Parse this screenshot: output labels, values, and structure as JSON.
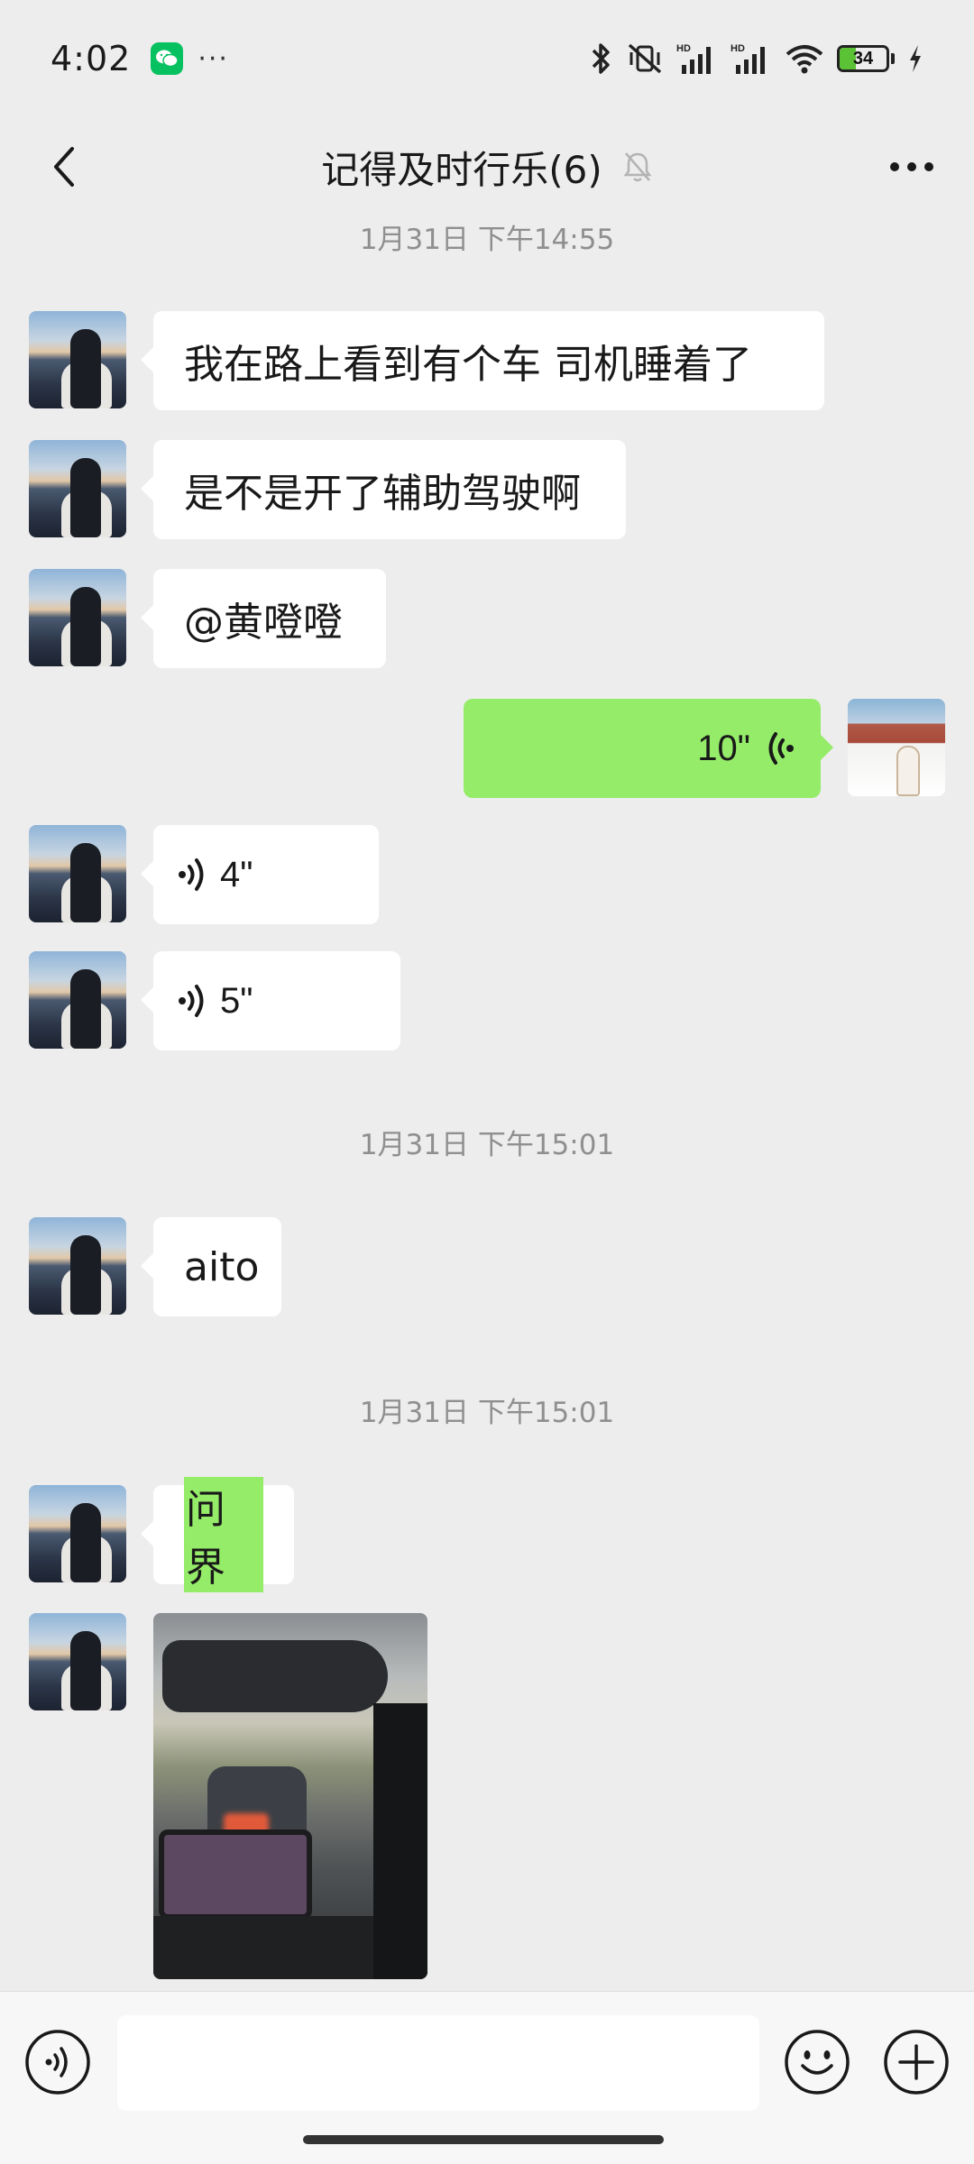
{
  "status_bar": {
    "time": "4:02",
    "dots": "···",
    "battery_level": "34",
    "battery_fraction": 0.34,
    "icons": [
      "wechat-notification-icon",
      "bluetooth-icon",
      "vibrate-off-icon",
      "signal-icon",
      "signal-icon",
      "wifi-icon",
      "battery-icon",
      "charging-icon"
    ]
  },
  "nav": {
    "title": "记得及时行乐(6)",
    "back_icon": "chevron-left-icon",
    "mute_icon": "bell-muted-icon",
    "more_icon": "more-horizontal-icon"
  },
  "messages": [
    {
      "type": "time",
      "text": "1月31日 下午14:55"
    },
    {
      "type": "text",
      "side": "left",
      "text": "我在路上看到有个车 司机睡着了"
    },
    {
      "type": "text",
      "side": "left",
      "text": "是不是开了辅助驾驶啊"
    },
    {
      "type": "text",
      "side": "left",
      "text": "@黄噔噔"
    },
    {
      "type": "voice",
      "side": "right",
      "duration": "10\""
    },
    {
      "type": "voice",
      "side": "left",
      "duration": "4\""
    },
    {
      "type": "voice",
      "side": "left",
      "duration": "5\""
    },
    {
      "type": "time",
      "text": "1月31日 下午15:01"
    },
    {
      "type": "text",
      "side": "left",
      "text": "aito"
    },
    {
      "type": "time",
      "text": "1月31日 下午15:01"
    },
    {
      "type": "text",
      "side": "left",
      "text": "问界",
      "highlighted": true
    },
    {
      "type": "image",
      "side": "left"
    }
  ],
  "input_bar": {
    "voice_icon": "voice-input-icon",
    "emoji_icon": "emoji-icon",
    "plus_icon": "plus-circle-icon",
    "placeholder": ""
  },
  "colors": {
    "background": "#EDEDED",
    "bubble_self": "#95EC69",
    "bubble_other": "#FFFFFF",
    "wechat_green": "#07C160"
  }
}
